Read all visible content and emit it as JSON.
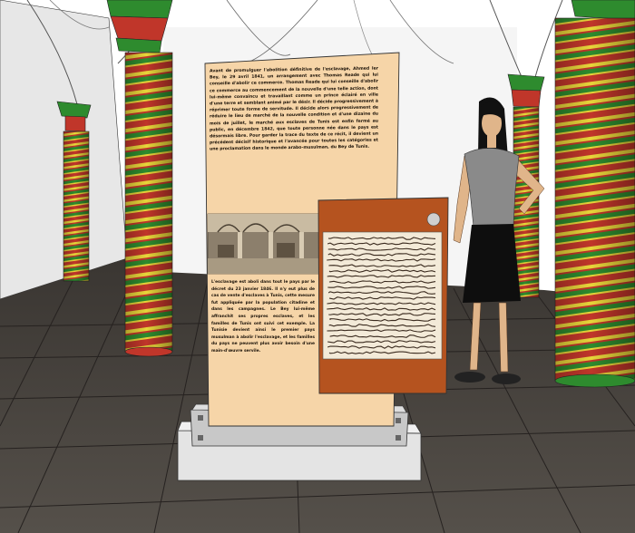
{
  "scene": {
    "palette": {
      "floor": "#4a4540",
      "floor_lines": "#2a2622",
      "wall": "#f2f2f2",
      "column_red": "#c0362a",
      "column_green": "#2e8b2e",
      "column_yellow": "#e8d53a",
      "panel_cream": "#f6d5a8",
      "panel_orange": "#b5531f",
      "base_grey": "#d6d6d6"
    },
    "panel_text_upper": "Avant de promulguer l'abolition définitive de l'esclavage, Ahmed Ier Bey, le 29 avril 1841, un arrangement avec Thomas Reade qui lui conseille d'abolir ce commerce. Thomas Reade qui lui conseille d'abolir ce commerce au commencement de la nouvelle d'une telle action, dont lui-même convaincu et travaillant comme un prince éclairé en ville d'une terre et semblant animé par le désir. Il décide progressivement à réprimer toute forme de servitude. Il décide alors progressivement de réduire le lieu de marché de la nouvelle condition et d'une dizaine du mois de juillet, le marché aux esclaves de Tunis est enfin fermé au public, en décembre 1842, que toute personne née dans le pays est désormais libre. Pour garder la trace du texte de ce récit, il devient un précédent décisif historique et l'avancée pour toutes les catégories et une proclamation dans le monde arabo-musulman, du Bey de Tunis.",
    "panel_text_lower": "L'esclavage est aboli dans tout le pays par le décret du 23 janvier 1846. Il n'y eut plus de cas de vente d'esclaves à Tunis, cette mesure fut appliquée par la population citadine et dans les campagnes. Le Bey lui-même affranchit ses propres esclaves, et les familles de Tunis ont suivi cet exemple. La Tunisie devient ainsi le premier pays musulman à abolir l'esclavage, et les familles du pays ne peuvent plus avoir besoin d'une main-d'œuvre servile."
  }
}
